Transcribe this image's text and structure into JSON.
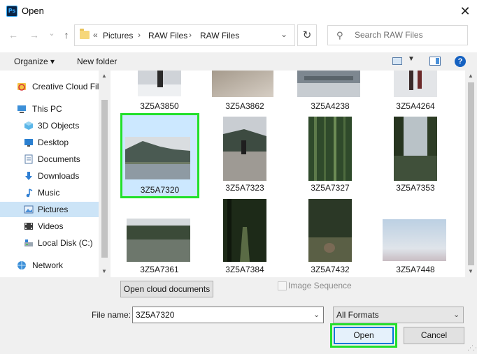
{
  "window": {
    "app_icon_text": "Ps",
    "title": "Open",
    "close_glyph": "✕"
  },
  "nav_buttons": {
    "back": "←",
    "forward": "→",
    "recent": "⌄",
    "up": "↑"
  },
  "address": {
    "overflow": "«",
    "separator": "›",
    "crumbs": [
      "Pictures",
      "RAW Files",
      "RAW Files"
    ],
    "dropdown_glyph": "⌄",
    "refresh_glyph": "↻"
  },
  "search": {
    "placeholder": "Search RAW Files",
    "icon_glyph": "⚲"
  },
  "toolbar": {
    "organize_label": "Organize ▾",
    "new_folder_label": "New folder",
    "view_dropdown_glyph": "▼",
    "help_label": "?"
  },
  "sidebar": {
    "items": [
      {
        "label": "Creative Cloud Fil",
        "icon": "creative-cloud-icon"
      },
      {
        "label": "This PC",
        "icon": "computer-icon"
      },
      {
        "label": "3D Objects",
        "icon": "cube-icon"
      },
      {
        "label": "Desktop",
        "icon": "desktop-icon"
      },
      {
        "label": "Documents",
        "icon": "document-icon"
      },
      {
        "label": "Downloads",
        "icon": "download-icon"
      },
      {
        "label": "Music",
        "icon": "music-icon"
      },
      {
        "label": "Pictures",
        "icon": "pictures-icon",
        "selected": true
      },
      {
        "label": "Videos",
        "icon": "video-icon"
      },
      {
        "label": "Local Disk (C:)",
        "icon": "disk-icon"
      },
      {
        "label": "Network",
        "icon": "network-icon"
      }
    ]
  },
  "files": [
    {
      "name": "3Z5A3850",
      "icon": "snowy-runner-thumbnail"
    },
    {
      "name": "3Z5A3862",
      "icon": "blurry-sand-thumbnail"
    },
    {
      "name": "3Z5A4238",
      "icon": "snowy-riverbank-thumbnail"
    },
    {
      "name": "3Z5A4264",
      "icon": "snowy-legs-thumbnail"
    },
    {
      "name": "3Z5A7320",
      "icon": "lake-mountain-thumbnail",
      "selected": true
    },
    {
      "name": "3Z5A7323",
      "icon": "cyclist-road-thumbnail"
    },
    {
      "name": "3Z5A7327",
      "icon": "bamboo-forest-thumbnail"
    },
    {
      "name": "3Z5A7353",
      "icon": "forest-lake-thumbnail"
    },
    {
      "name": "3Z5A7361",
      "icon": "misty-lake-thumbnail"
    },
    {
      "name": "3Z5A7384",
      "icon": "dark-forest-path-thumbnail"
    },
    {
      "name": "3Z5A7432",
      "icon": "rabbit-thumbnail"
    },
    {
      "name": "3Z5A7448",
      "icon": "pale-sky-thumbnail"
    }
  ],
  "bottom": {
    "cloud_button": "Open cloud documents",
    "image_sequence_label": "Image Sequence",
    "image_sequence_checked": false,
    "file_name_label": "File name:",
    "file_name_value": "3Z5A7320",
    "format_value": "All Formats",
    "dropdown_glyph": "⌄",
    "open_label": "Open",
    "cancel_label": "Cancel"
  },
  "colors": {
    "selection_bg": "#cce8ff",
    "highlight_outline": "#22e02a",
    "accent_blue": "#0078d7"
  }
}
